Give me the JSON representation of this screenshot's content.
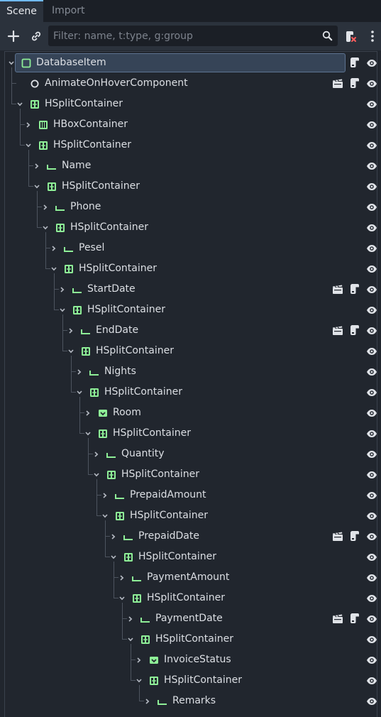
{
  "tabs": [
    {
      "label": "Scene"
    },
    {
      "label": "Import"
    }
  ],
  "toolbar": {
    "add_icon": "plus-icon",
    "link_icon": "link-icon",
    "filter_placeholder": "Filter: name, t:type, g:group",
    "search_icon": "search-icon",
    "script_icon": "script-remove-icon",
    "menu_icon": "kebab-menu-icon"
  },
  "colors": {
    "accent": "#70bafa",
    "node_green": "#8eef97",
    "selection": "#364457",
    "background": "#21262e"
  },
  "tree": [
    {
      "name": "DatabaseItem",
      "type": "control",
      "depth": 0,
      "expanded": true,
      "selected": true,
      "badges": [
        "script"
      ]
    },
    {
      "name": "AnimateOnHoverComponent",
      "type": "node",
      "depth": 1,
      "expanded": null,
      "badges": [
        "scene",
        "script"
      ]
    },
    {
      "name": "HSplitContainer",
      "type": "hsplit",
      "depth": 1,
      "expanded": true,
      "badges": []
    },
    {
      "name": "HBoxContainer",
      "type": "hbox",
      "depth": 2,
      "expanded": false,
      "badges": []
    },
    {
      "name": "HSplitContainer",
      "type": "hsplit",
      "depth": 2,
      "expanded": true,
      "badges": []
    },
    {
      "name": "Name",
      "type": "label",
      "depth": 3,
      "expanded": false,
      "badges": []
    },
    {
      "name": "HSplitContainer",
      "type": "hsplit",
      "depth": 3,
      "expanded": true,
      "badges": []
    },
    {
      "name": "Phone",
      "type": "label",
      "depth": 4,
      "expanded": false,
      "badges": []
    },
    {
      "name": "HSplitContainer",
      "type": "hsplit",
      "depth": 4,
      "expanded": true,
      "badges": []
    },
    {
      "name": "Pesel",
      "type": "label",
      "depth": 5,
      "expanded": false,
      "badges": []
    },
    {
      "name": "HSplitContainer",
      "type": "hsplit",
      "depth": 5,
      "expanded": true,
      "badges": []
    },
    {
      "name": "StartDate",
      "type": "label",
      "depth": 6,
      "expanded": false,
      "badges": [
        "scene",
        "script"
      ]
    },
    {
      "name": "HSplitContainer",
      "type": "hsplit",
      "depth": 6,
      "expanded": true,
      "badges": []
    },
    {
      "name": "EndDate",
      "type": "label",
      "depth": 7,
      "expanded": false,
      "badges": [
        "scene",
        "script"
      ]
    },
    {
      "name": "HSplitContainer",
      "type": "hsplit",
      "depth": 7,
      "expanded": true,
      "badges": []
    },
    {
      "name": "Nights",
      "type": "label",
      "depth": 8,
      "expanded": false,
      "badges": []
    },
    {
      "name": "HSplitContainer",
      "type": "hsplit",
      "depth": 8,
      "expanded": true,
      "badges": []
    },
    {
      "name": "Room",
      "type": "option",
      "depth": 9,
      "expanded": false,
      "badges": []
    },
    {
      "name": "HSplitContainer",
      "type": "hsplit",
      "depth": 9,
      "expanded": true,
      "badges": []
    },
    {
      "name": "Quantity",
      "type": "label",
      "depth": 10,
      "expanded": false,
      "badges": []
    },
    {
      "name": "HSplitContainer",
      "type": "hsplit",
      "depth": 10,
      "expanded": true,
      "badges": []
    },
    {
      "name": "PrepaidAmount",
      "type": "label",
      "depth": 11,
      "expanded": false,
      "badges": []
    },
    {
      "name": "HSplitContainer",
      "type": "hsplit",
      "depth": 11,
      "expanded": true,
      "badges": []
    },
    {
      "name": "PrepaidDate",
      "type": "label",
      "depth": 12,
      "expanded": false,
      "badges": [
        "scene",
        "script"
      ]
    },
    {
      "name": "HSplitContainer",
      "type": "hsplit",
      "depth": 12,
      "expanded": true,
      "badges": []
    },
    {
      "name": "PaymentAmount",
      "type": "label",
      "depth": 13,
      "expanded": false,
      "badges": []
    },
    {
      "name": "HSplitContainer",
      "type": "hsplit",
      "depth": 13,
      "expanded": true,
      "badges": []
    },
    {
      "name": "PaymentDate",
      "type": "label",
      "depth": 14,
      "expanded": false,
      "badges": [
        "scene",
        "script"
      ]
    },
    {
      "name": "HSplitContainer",
      "type": "hsplit",
      "depth": 14,
      "expanded": true,
      "badges": []
    },
    {
      "name": "InvoiceStatus",
      "type": "option",
      "depth": 15,
      "expanded": false,
      "badges": []
    },
    {
      "name": "HSplitContainer",
      "type": "hsplit",
      "depth": 15,
      "expanded": true,
      "badges": []
    },
    {
      "name": "Remarks",
      "type": "label",
      "depth": 16,
      "expanded": false,
      "badges": []
    }
  ]
}
